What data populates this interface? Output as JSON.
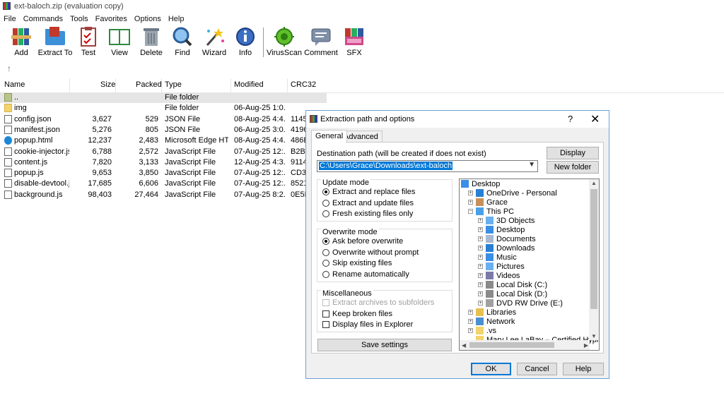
{
  "window": {
    "title": "ext-baloch.zip (evaluation copy)"
  },
  "menu": [
    "File",
    "Commands",
    "Tools",
    "Favorites",
    "Options",
    "Help"
  ],
  "toolbar": [
    {
      "label": "Add",
      "icon": "add-books-icon"
    },
    {
      "label": "Extract To",
      "icon": "extract-folder-icon"
    },
    {
      "label": "Test",
      "icon": "test-clipboard-icon"
    },
    {
      "label": "View",
      "icon": "view-book-icon"
    },
    {
      "label": "Delete",
      "icon": "delete-trash-icon"
    },
    {
      "label": "Find",
      "icon": "find-magnifier-icon"
    },
    {
      "label": "Wizard",
      "icon": "wizard-wand-icon"
    },
    {
      "label": "Info",
      "icon": "info-icon"
    },
    {
      "label": "VirusScan",
      "icon": "virus-scan-icon"
    },
    {
      "label": "Comment",
      "icon": "comment-icon"
    },
    {
      "label": "SFX",
      "icon": "sfx-icon"
    }
  ],
  "up_arrow": "↑",
  "columns": {
    "name": "Name",
    "size": "Size",
    "packed": "Packed",
    "type": "Type",
    "modified": "Modified",
    "crc": "CRC32"
  },
  "files": [
    {
      "name": "..",
      "size": "",
      "packed": "",
      "type": "File folder",
      "modified": "",
      "crc": "",
      "icon": "folder-up-icon"
    },
    {
      "name": "img",
      "size": "",
      "packed": "",
      "type": "File folder",
      "modified": "06-Aug-25 1:0...",
      "crc": "",
      "icon": "folder-icon"
    },
    {
      "name": "config.json",
      "size": "3,627",
      "packed": "529",
      "type": "JSON File",
      "modified": "08-Aug-25 4:4...",
      "crc": "1145",
      "icon": "json-file-icon"
    },
    {
      "name": "manifest.json",
      "size": "5,276",
      "packed": "805",
      "type": "JSON File",
      "modified": "06-Aug-25 3:0...",
      "crc": "4196",
      "icon": "json-file-icon"
    },
    {
      "name": "popup.html",
      "size": "12,237",
      "packed": "2,483",
      "type": "Microsoft Edge HT...",
      "modified": "08-Aug-25 4:4...",
      "crc": "486B",
      "icon": "edge-html-icon"
    },
    {
      "name": "cookie-injector.js",
      "size": "6,788",
      "packed": "2,572",
      "type": "JavaScript File",
      "modified": "07-Aug-25 12:...",
      "crc": "B2B5",
      "icon": "js-file-icon"
    },
    {
      "name": "content.js",
      "size": "7,820",
      "packed": "3,133",
      "type": "JavaScript File",
      "modified": "12-Aug-25 4:3...",
      "crc": "9114",
      "icon": "js-file-icon"
    },
    {
      "name": "popup.js",
      "size": "9,653",
      "packed": "3,850",
      "type": "JavaScript File",
      "modified": "07-Aug-25 12:...",
      "crc": "CD30",
      "icon": "js-file-icon"
    },
    {
      "name": "disable-devtool.js",
      "size": "17,685",
      "packed": "6,606",
      "type": "JavaScript File",
      "modified": "07-Aug-25 12:...",
      "crc": "8521",
      "icon": "js-file-icon"
    },
    {
      "name": "background.js",
      "size": "98,403",
      "packed": "27,464",
      "type": "JavaScript File",
      "modified": "07-Aug-25 8:2...",
      "crc": "0E5F",
      "icon": "js-file-icon"
    }
  ],
  "dialog": {
    "title": "Extraction path and options",
    "help": "?",
    "close": "✕",
    "tabs": [
      "General",
      "Advanced"
    ],
    "dest_label": "Destination path (will be created if does not exist)",
    "dest_value": "C:\\Users\\Grace\\Downloads\\ext-baloch",
    "display_btn": "Display",
    "newfolder_btn": "New folder",
    "update_mode": {
      "title": "Update mode",
      "options": [
        "Extract and replace files",
        "Extract and update files",
        "Fresh existing files only"
      ],
      "selected": 0
    },
    "overwrite_mode": {
      "title": "Overwrite mode",
      "options": [
        "Ask before overwrite",
        "Overwrite without prompt",
        "Skip existing files",
        "Rename automatically"
      ],
      "selected": 0
    },
    "misc": {
      "title": "Miscellaneous",
      "options": [
        "Extract archives to subfolders",
        "Keep broken files",
        "Display files in Explorer"
      ],
      "disabled": [
        true,
        false,
        false
      ],
      "checked": [
        false,
        false,
        false
      ]
    },
    "save_btn": "Save settings",
    "ok_btn": "OK",
    "cancel_btn": "Cancel",
    "help_btn": "Help",
    "tree": [
      {
        "label": "Desktop",
        "icon": "desktop-icon",
        "expander": ""
      },
      {
        "label": "OneDrive - Personal",
        "icon": "onedrive-icon",
        "expander": "+"
      },
      {
        "label": "Grace",
        "icon": "user-icon",
        "expander": "+"
      },
      {
        "label": "This PC",
        "icon": "pc-icon",
        "expander": "−"
      },
      {
        "label": "3D Objects",
        "icon": "objects-3d-icon",
        "expander": "+"
      },
      {
        "label": "Desktop",
        "icon": "desktop-icon",
        "expander": "+"
      },
      {
        "label": "Documents",
        "icon": "documents-icon",
        "expander": "+"
      },
      {
        "label": "Downloads",
        "icon": "downloads-icon",
        "expander": "+"
      },
      {
        "label": "Music",
        "icon": "music-icon",
        "expander": "+"
      },
      {
        "label": "Pictures",
        "icon": "pictures-icon",
        "expander": "+"
      },
      {
        "label": "Videos",
        "icon": "videos-icon",
        "expander": "+"
      },
      {
        "label": "Local Disk (C:)",
        "icon": "disk-icon",
        "expander": "+"
      },
      {
        "label": "Local Disk (D:)",
        "icon": "disk-icon",
        "expander": "+"
      },
      {
        "label": "DVD RW Drive (E:)",
        "icon": "dvd-icon",
        "expander": "+"
      },
      {
        "label": "Libraries",
        "icon": "libraries-icon",
        "expander": "+"
      },
      {
        "label": "Network",
        "icon": "network-icon",
        "expander": "+"
      },
      {
        "label": ".vs",
        "icon": "folder-icon",
        "expander": "+"
      },
      {
        "label": "Mary Lee LaBay – Certified Hypnothe",
        "icon": "folder-icon",
        "expander": ""
      }
    ]
  }
}
